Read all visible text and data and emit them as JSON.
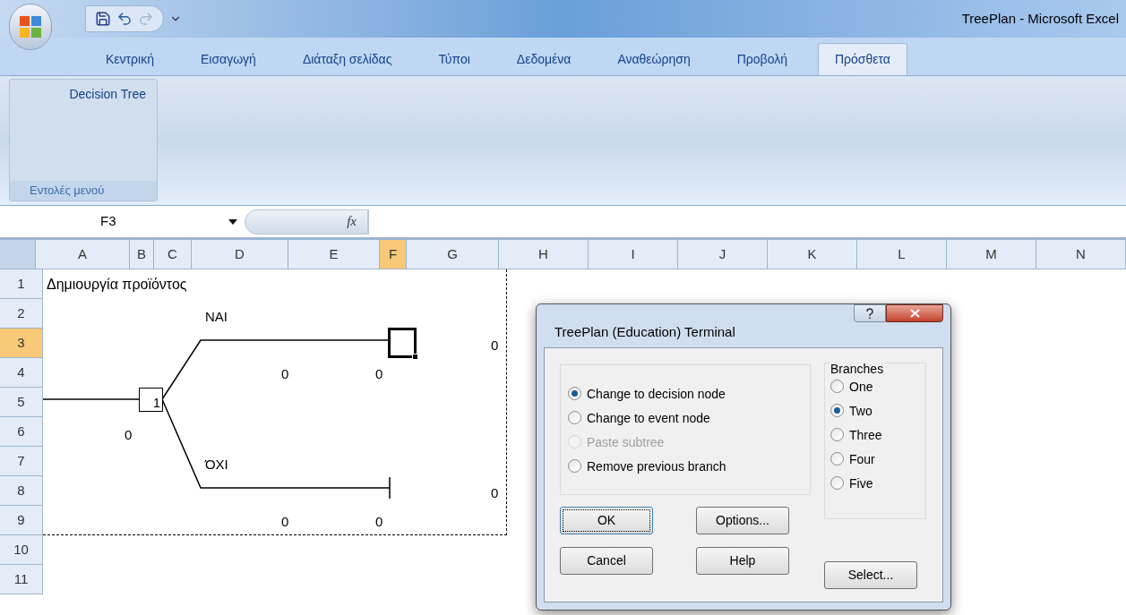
{
  "window": {
    "title": "TreePlan - Microsoft Excel"
  },
  "tabs": [
    {
      "label": "Κεντρική",
      "selected": false
    },
    {
      "label": "Εισαγωγή",
      "selected": false
    },
    {
      "label": "Διάταξη σελίδας",
      "selected": false
    },
    {
      "label": "Τύποι",
      "selected": false
    },
    {
      "label": "Δεδομένα",
      "selected": false
    },
    {
      "label": "Αναθεώρηση",
      "selected": false
    },
    {
      "label": "Προβολή",
      "selected": false
    },
    {
      "label": "Πρόσθετα",
      "selected": true
    }
  ],
  "ribbon": {
    "group": {
      "button": "Decision Tree",
      "label": "Εντολές μενού"
    }
  },
  "formula_bar": {
    "name_box": "F3",
    "function_label": "fx"
  },
  "columns": [
    {
      "label": "A",
      "selected": false
    },
    {
      "label": "B",
      "selected": false
    },
    {
      "label": "C",
      "selected": false
    },
    {
      "label": "D",
      "selected": false
    },
    {
      "label": "E",
      "selected": false
    },
    {
      "label": "F",
      "selected": true
    },
    {
      "label": "G",
      "selected": false
    },
    {
      "label": "H",
      "selected": false
    },
    {
      "label": "I",
      "selected": false
    },
    {
      "label": "J",
      "selected": false
    },
    {
      "label": "K",
      "selected": false
    },
    {
      "label": "L",
      "selected": false
    },
    {
      "label": "M",
      "selected": false
    },
    {
      "label": "N",
      "selected": false
    }
  ],
  "rows": [
    {
      "label": "1",
      "selected": false
    },
    {
      "label": "2",
      "selected": false
    },
    {
      "label": "3",
      "selected": true
    },
    {
      "label": "4",
      "selected": false
    },
    {
      "label": "5",
      "selected": false
    },
    {
      "label": "6",
      "selected": false
    },
    {
      "label": "7",
      "selected": false
    },
    {
      "label": "8",
      "selected": false
    },
    {
      "label": "9",
      "selected": false
    },
    {
      "label": "10",
      "selected": false
    },
    {
      "label": "11",
      "selected": false
    }
  ],
  "tree": {
    "title": "Δημιουργία προϊόντος",
    "root_value": "0",
    "node": "1",
    "branches": [
      {
        "label": "NAI",
        "value": "0",
        "cumulative": "0",
        "result": "0",
        "kind": "open"
      },
      {
        "label": "ΌΧΙ",
        "value": "0",
        "cumulative": "0",
        "result": "0",
        "kind": "terminal"
      }
    ]
  },
  "dialog": {
    "title": "TreePlan (Education) Terminal",
    "actions": [
      {
        "label": "Change to decision node",
        "selected": true,
        "disabled": false
      },
      {
        "label": "Change to event node",
        "selected": false,
        "disabled": false
      },
      {
        "label": "Paste subtree",
        "selected": false,
        "disabled": true
      },
      {
        "label": "Remove previous branch",
        "selected": false,
        "disabled": false
      }
    ],
    "branches_label": "Branches",
    "branches": [
      {
        "label": "One",
        "selected": false
      },
      {
        "label": "Two",
        "selected": true
      },
      {
        "label": "Three",
        "selected": false
      },
      {
        "label": "Four",
        "selected": false
      },
      {
        "label": "Five",
        "selected": false
      }
    ],
    "buttons": [
      {
        "label": "OK",
        "default": true
      },
      {
        "label": "Options..."
      },
      {
        "label": "Cancel"
      },
      {
        "label": "Help"
      },
      {
        "label": "Select..."
      }
    ]
  }
}
